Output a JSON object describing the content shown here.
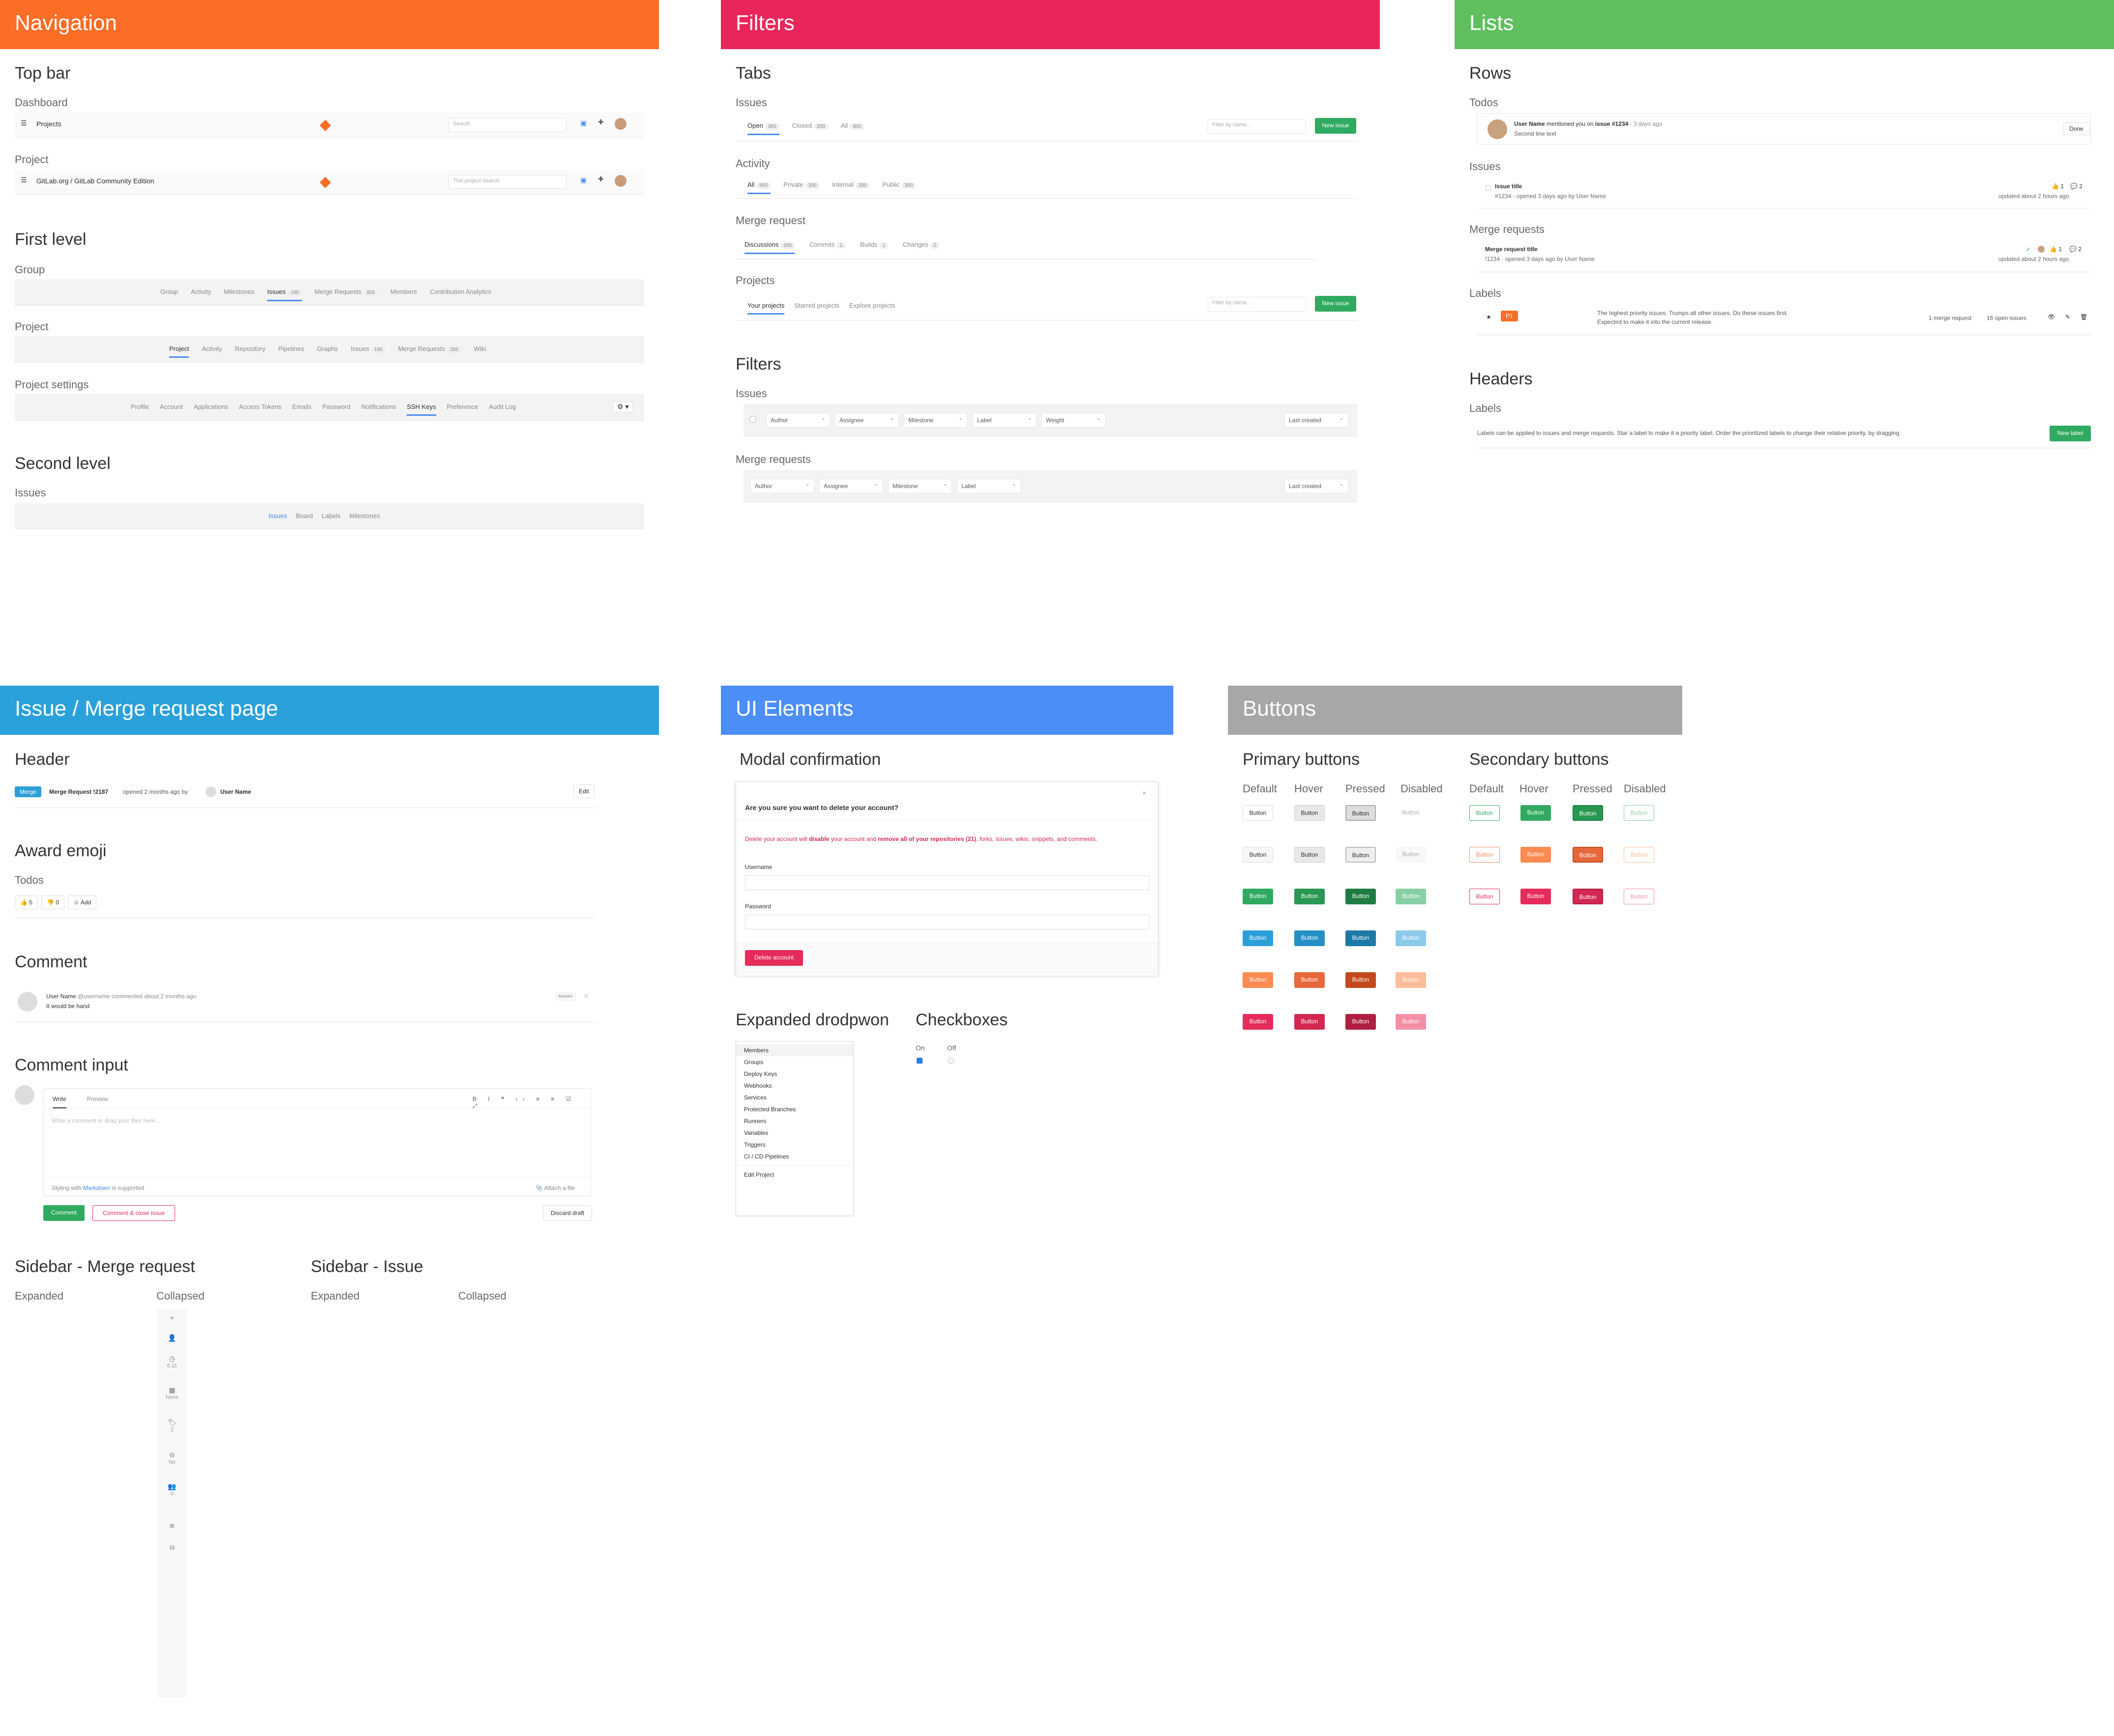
{
  "banners": {
    "navigation": {
      "label": "Navigation",
      "color": "#fc6d26"
    },
    "filters": {
      "label": "Filters",
      "color": "#e8265a"
    },
    "lists": {
      "label": "Lists",
      "color": "#5fbf5f"
    },
    "issue_mr": {
      "label": "Issue / Merge request page",
      "color": "#2aa1da"
    },
    "ui_elements": {
      "label": "UI Elements",
      "color": "#4c8ef7"
    },
    "buttons": {
      "label": "Buttons",
      "color": "#a7a7a7"
    }
  },
  "navigation": {
    "top_bar": "Top bar",
    "dashboard": "Dashboard",
    "projects": "Projects",
    "search_placeholder": "Search",
    "project": "Project",
    "project_path": "GitLab.org / GitLab Community Edition",
    "this_project": "This project",
    "first_level": "First level",
    "group": "Group",
    "group_tabs": [
      "Group",
      "Activity",
      "Milestones",
      "Issues",
      "Merge Requests",
      "Members",
      "Contribution Analytics"
    ],
    "group_badges": {
      "issues": "190",
      "mr": "333"
    },
    "project_label": "Project",
    "project_tabs": [
      "Project",
      "Activity",
      "Repository",
      "Pipelines",
      "Graphs",
      "Issues",
      "Merge Requests",
      "Wiki"
    ],
    "project_badges": {
      "issues": "190",
      "mr": "256"
    },
    "project_settings": "Project settings",
    "settings_tabs": [
      "Profile",
      "Account",
      "Applications",
      "Access Tokens",
      "Emails",
      "Password",
      "Notifications",
      "SSH Keys",
      "Preference",
      "Audit Log"
    ],
    "second_level": "Second level",
    "issues": "Issues",
    "second_tabs": [
      "Issues",
      "Board",
      "Labels",
      "Milestones"
    ]
  },
  "filters": {
    "tabs": "Tabs",
    "issues": "Issues",
    "issue_tabs": [
      {
        "label": "Open",
        "count": "300"
      },
      {
        "label": "Closed",
        "count": "200"
      },
      {
        "label": "All",
        "count": "300"
      }
    ],
    "filter_placeholder": "Filter by name...",
    "new_issue": "New issue",
    "activity": "Activity",
    "activity_tabs": [
      {
        "label": "All",
        "count": "600"
      },
      {
        "label": "Private",
        "count": "200"
      },
      {
        "label": "Internal",
        "count": "200"
      },
      {
        "label": "Public",
        "count": "300"
      }
    ],
    "merge_request": "Merge request",
    "mr_tabs": [
      {
        "label": "Discussions",
        "count": "280"
      },
      {
        "label": "Commits",
        "count": "1"
      },
      {
        "label": "Builds",
        "count": "1"
      },
      {
        "label": "Changes",
        "count": "2"
      }
    ],
    "projects": "Projects",
    "project_tabs": [
      "Your projects",
      "Starred projects",
      "Explore projects"
    ],
    "filters": "Filters",
    "filter_issues": "Issues",
    "issue_dropdowns": [
      "Author",
      "Assignee",
      "Milestone",
      "Label",
      "Weight"
    ],
    "sort": "Last created",
    "merge_requests": "Merge requests",
    "mr_dropdowns": [
      "Author",
      "Assignee",
      "Milestone",
      "Label"
    ]
  },
  "lists": {
    "rows": "Rows",
    "todos": "Todos",
    "todo_user": "User Name",
    "todo_text": "mentioned you on",
    "todo_issue": "issue #1234",
    "todo_time": "· 3 days ago",
    "todo_second": "Second line text",
    "done": "Done",
    "issues": "Issues",
    "issue_title": "Issue title",
    "issue_meta": "#1234 · opened 3 days ago by",
    "issue_user": "User Name",
    "issue_updated": "updated about 2 hours ago",
    "thumbs": "1",
    "comments": "2",
    "merge_requests": "Merge requests",
    "mr_title": "Merge request title",
    "mr_meta": "!1234 · opened 3 days ago by",
    "mr_user": "User Name",
    "mr_updated": "updated about 2 hours ago",
    "labels": "Labels",
    "label_tag": "P1",
    "label_desc_1": "The highest priority issues. Trumps all other issues. Do these issues first.",
    "label_desc_2": "Expected to make it into the current release.",
    "label_mrs": "1 merge request",
    "label_issues": "16 open issues",
    "headers": "Headers",
    "headers_labels": "Labels",
    "headers_text": "Labels can be applied to issues and merge requests. Star a label to make it a priority label. Order the prioritized labels to change their relative priority, by dragging.",
    "new_label": "New label"
  },
  "issue_page": {
    "header": "Header",
    "merge_badge": "Merge",
    "mr_ref": "Merge Request !2187",
    "opened": "opened 2 months ago by",
    "user": "User Name",
    "edit": "Edit",
    "award_emoji": "Award emoji",
    "todos": "Todos",
    "thumbs_up": "5",
    "thumbs_down": "0",
    "add": "Add",
    "comment": "Comment",
    "comment_user": "User Name",
    "comment_handle": "@username commented about 2 months ago",
    "comment_body": "It would be hand",
    "master": "Master",
    "comment_input": "Comment input",
    "write": "Write",
    "preview": "Preview",
    "comment_placeholder": "Write a comment or drag your files here...",
    "styling": "Styling with",
    "markdown": "Markdown",
    "supported": "is supported",
    "attach": "Attach a file",
    "comment_btn": "Comment",
    "comment_close": "Comment & close issue",
    "discard": "Discard draft",
    "sidebar_mr": "Sidebar - Merge request",
    "sidebar_issue": "Sidebar - Issue",
    "expanded": "Expanded",
    "collapsed": "Collapsed",
    "sb_values": [
      "6.11",
      "None",
      "2",
      "No",
      "0"
    ]
  },
  "ui_elements": {
    "modal_confirmation": "Modal confirmation",
    "modal_title": "Are you sure you want to delete your account?",
    "modal_text_1": "Delete your account will",
    "modal_disable": "disable",
    "modal_text_2": "your account and",
    "modal_remove": "remove all of your repositories (21)",
    "modal_text_3": ", forks, issues, wikis, snippets, and comments.",
    "username": "Username",
    "password": "Password",
    "delete_account": "Delete account",
    "expanded_dropdown": "Expanded drodpwon",
    "dropdown_items": [
      "Members",
      "Groups",
      "Deploy Keys",
      "Webhooks",
      "Services",
      "Protected Branches",
      "Runners",
      "Variables",
      "Triggers",
      "CI / CD Pipelines"
    ],
    "edit_project": "Edit Project",
    "checkboxes": "Checkboxes",
    "on": "On",
    "off": "Off"
  },
  "buttons": {
    "primary": "Primary buttons",
    "secondary": "Secondary buttons",
    "states": [
      "Default",
      "Hover",
      "Pressed",
      "Disabled"
    ],
    "label": "Button",
    "primary_colors": [
      "#f0f0f0",
      "#2faa60",
      "#2d9fd8",
      "#fc8a51",
      "#e52c5a"
    ],
    "secondary_colors": [
      "#2faa60",
      "#fc8a51",
      "#e52c5a"
    ]
  }
}
